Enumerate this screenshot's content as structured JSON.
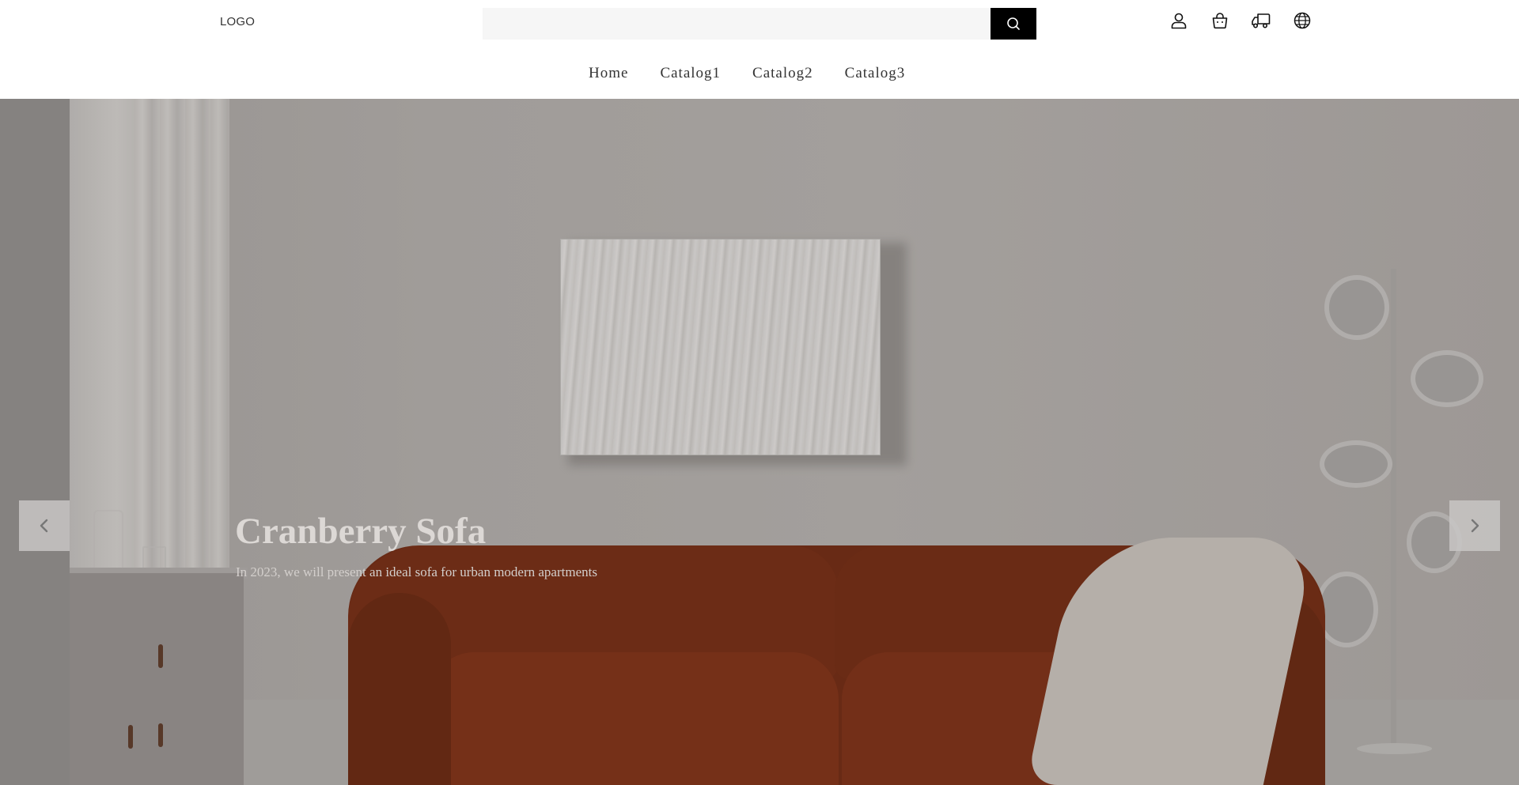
{
  "header": {
    "logo": "LOGO",
    "search": {
      "placeholder": "",
      "value": ""
    },
    "icons": [
      "user-icon",
      "basket-icon",
      "delivery-truck-icon",
      "globe-icon"
    ]
  },
  "nav": {
    "items": [
      "Home",
      "Catalog1",
      "Catalog2",
      "Catalog3"
    ]
  },
  "hero": {
    "title": "Cranberry Sofa",
    "subtitle": "In 2023, we will present an ideal sofa for urban modern apartments",
    "prev_icon": "chevron-left-icon",
    "next_icon": "chevron-right-icon"
  },
  "colors": {
    "search_button": "#000000",
    "sofa": "#712e17",
    "wall": "#a7a3a0"
  }
}
